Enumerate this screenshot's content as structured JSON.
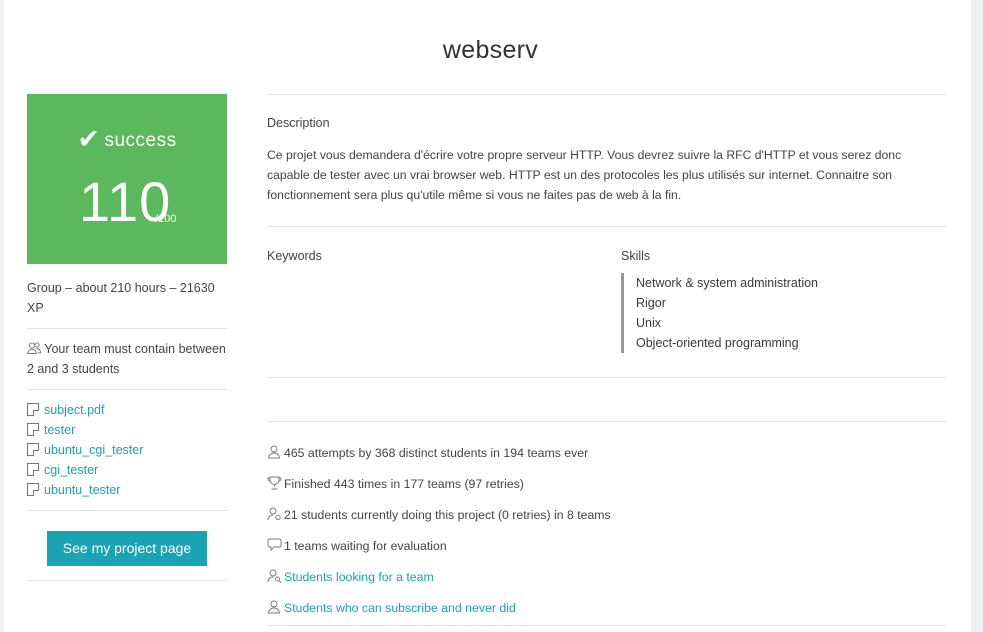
{
  "project": {
    "title": "webserv"
  },
  "score": {
    "status": "success",
    "value": "110",
    "max": "/100",
    "status_color": "#5cb85c"
  },
  "meta": {
    "summary": "Group – about 210 hours – 21630 XP",
    "team_requirement": "Your team must contain between 2 and 3 students"
  },
  "files": [
    {
      "name": "subject.pdf",
      "icon": "file-icon"
    },
    {
      "name": "tester",
      "icon": "file-icon"
    },
    {
      "name": "ubuntu_cgi_tester",
      "icon": "file-icon"
    },
    {
      "name": "cgi_tester",
      "icon": "file-icon"
    },
    {
      "name": "ubuntu_tester",
      "icon": "file-icon"
    }
  ],
  "actions": {
    "project_page_label": "See my project page",
    "accent_color": "#19a3b5"
  },
  "description": {
    "label": "Description",
    "text": "Ce projet vous demandera d'écrire votre propre serveur HTTP. Vous devrez suivre la RFC d'HTTP et vous serez donc capable de tester avec un vrai browser web. HTTP est un des protocoles les plus utilisés sur internet. Connaitre son fonctionnement sera plus qu'utile même si vous ne faites pas de web à la fin."
  },
  "keywords": {
    "label": "Keywords"
  },
  "skills": {
    "label": "Skills",
    "items": [
      "Network & system administration",
      "Rigor",
      "Unix",
      "Object-oriented programming"
    ]
  },
  "stats": {
    "attempts": "465 attempts by 368 distinct students in 194 teams ever",
    "finished": "Finished 443 times in 177 teams (97 retries)",
    "current": "21 students currently doing this project (0 retries) in 8 teams",
    "waiting": "1 teams waiting for evaluation",
    "looking_link": "Students looking for a team",
    "never_did_link": "Students who can subscribe and never did"
  }
}
